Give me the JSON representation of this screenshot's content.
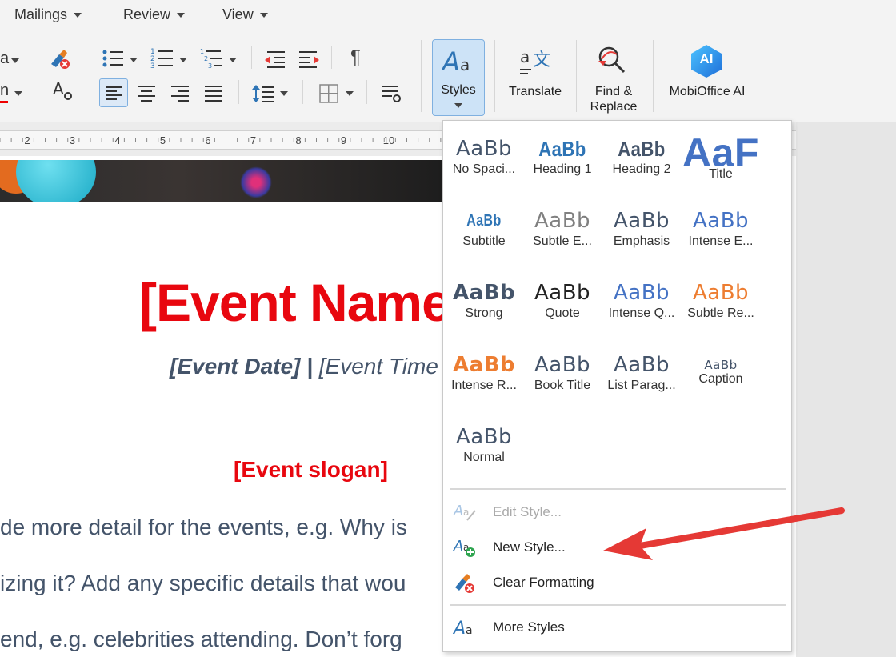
{
  "menubar": {
    "items": [
      "Mailings",
      "Review",
      "View"
    ]
  },
  "ribbon": {
    "styles_label": "Styles",
    "translate_label": "Translate",
    "find_label": "Find &\nReplace",
    "find_line1": "Find &",
    "find_line2": "Replace",
    "ai_label": "MobiOffice AI",
    "ai_badge": "AI",
    "pilcrow": "¶",
    "partial_left_1": "a",
    "partial_left_2": "n"
  },
  "ruler": {
    "numbers": [
      "2",
      "3",
      "4",
      "5",
      "6",
      "7",
      "8",
      "9",
      "10",
      "9"
    ]
  },
  "document": {
    "event_name": "[Event Name",
    "event_date": "[Event Date]",
    "pipe": " | ",
    "event_time": "[Event Time",
    "slogan": "[Event slogan]",
    "body_1": "de more detail for the events, e.g. Why is",
    "body_2": "izing it? Add any specific details that wou",
    "body_3": "end, e.g. celebrities attending. Don’t forg"
  },
  "styles_gallery": {
    "sample_text": "AaBb",
    "title_sample": "AaF",
    "items": [
      {
        "label": "No Spaci...",
        "color": "#44546a"
      },
      {
        "label": "Heading 1",
        "color": "#2e74b5"
      },
      {
        "label": "Heading 2",
        "color": "#44546a"
      },
      {
        "label": "Title",
        "color": "#4472c4"
      },
      {
        "label": "Subtitle",
        "color": "#2e74b5"
      },
      {
        "label": "Subtle E...",
        "color": "#808080"
      },
      {
        "label": "Emphasis",
        "color": "#44546a"
      },
      {
        "label": "Intense E...",
        "color": "#4472c4"
      },
      {
        "label": "Strong",
        "color": "#44546a"
      },
      {
        "label": "Quote",
        "color": "#222222"
      },
      {
        "label": "Intense Q...",
        "color": "#4472c4"
      },
      {
        "label": "Subtle Re...",
        "color": "#ed7d31"
      },
      {
        "label": "Intense R...",
        "color": "#ed7d31"
      },
      {
        "label": "Book Title",
        "color": "#44546a"
      },
      {
        "label": "List Parag...",
        "color": "#44546a"
      },
      {
        "label": "Caption",
        "color": "#44546a"
      },
      {
        "label": "Normal",
        "color": "#44546a"
      }
    ],
    "actions": {
      "edit_style": "Edit Style...",
      "new_style": "New Style...",
      "clear_formatting": "Clear Formatting",
      "more_styles": "More Styles"
    }
  },
  "colors": {
    "accent": "#2e74b5",
    "event_red": "#e8070f",
    "arrow_red": "#e53935"
  }
}
